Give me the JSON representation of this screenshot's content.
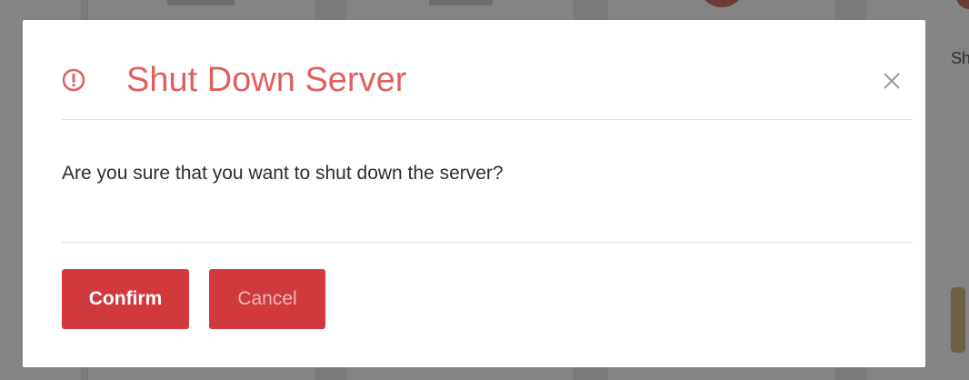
{
  "dialog": {
    "title": "Shut Down Server",
    "message": "Are you sure that you want to shut down the server?",
    "confirm_label": "Confirm",
    "cancel_label": "Cancel",
    "icons": {
      "header": "alert-circle-icon",
      "close": "close-icon"
    }
  },
  "background": {
    "partial_text": "Shut"
  },
  "colors": {
    "title": "#e06060",
    "button": "#d13a3d",
    "overlay": "#7b7b7b"
  }
}
